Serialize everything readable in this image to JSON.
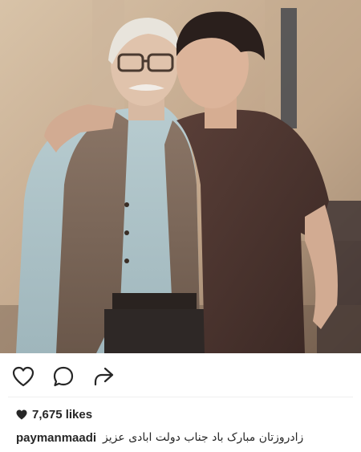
{
  "post": {
    "photo_icon": "photo",
    "likes": "7,675 likes",
    "username": "paymanmaadi",
    "caption": "زادروزتان مبارک باد جناب دولت ابادی  عزیز"
  },
  "actions": {
    "like_icon": "heart-outline-icon",
    "comment_icon": "comment-bubble-icon",
    "share_icon": "share-arrow-icon"
  }
}
